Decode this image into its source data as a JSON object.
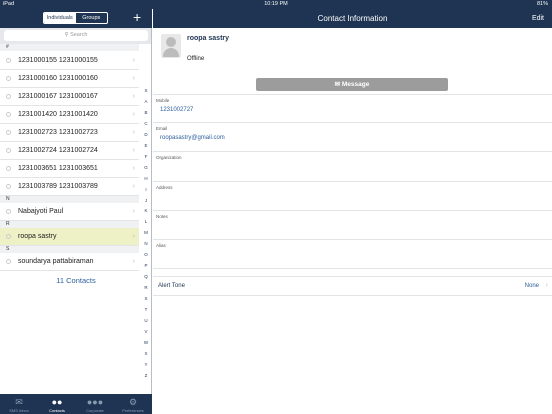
{
  "status": {
    "carrier": "iPad",
    "time": "10:19 PM",
    "battery": "81%"
  },
  "left_header": {
    "seg_individuals": "Individuals",
    "seg_groups": "Groups",
    "add": "+"
  },
  "search": {
    "placeholder": "Search"
  },
  "sections": {
    "hash": "#",
    "n": "N",
    "r": "R",
    "s": "S"
  },
  "contacts": [
    "1231000155 1231000155",
    "1231000160 1231000160",
    "1231000167 1231000167",
    "1231001420 1231001420",
    "1231002723 1231002723",
    "1231002724 1231002724",
    "1231003651 1231003651",
    "1231003789 1231003789",
    "Nabajyoti Paul",
    "roopa sastry",
    "soundarya pattabiraman"
  ],
  "contact_count": "11 Contacts",
  "index": [
    "S",
    "A",
    "B",
    "C",
    "D",
    "E",
    "F",
    "G",
    "H",
    "I",
    "J",
    "K",
    "L",
    "M",
    "N",
    "O",
    "P",
    "Q",
    "R",
    "S",
    "T",
    "U",
    "V",
    "W",
    "X",
    "Y",
    "Z"
  ],
  "tabbar": [
    {
      "label": "SMS Inbox",
      "icon": "envelope-icon"
    },
    {
      "label": "Contacts",
      "icon": "people-icon"
    },
    {
      "label": "Corporate",
      "icon": "group-icon"
    },
    {
      "label": "Preferences",
      "icon": "gear-icon"
    }
  ],
  "right_header": {
    "title": "Contact Information",
    "edit": "Edit"
  },
  "contact": {
    "name": "roopa sastry",
    "status": "Offline",
    "message_button": "Message",
    "fields": [
      {
        "label": "Mobile",
        "value": "1231002727"
      },
      {
        "label": "Email",
        "value": "roopasastry@gmail.com"
      },
      {
        "label": "Organization",
        "value": ""
      },
      {
        "label": "Address",
        "value": ""
      },
      {
        "label": "Notes",
        "value": ""
      },
      {
        "label": "Alias",
        "value": ""
      }
    ],
    "alert_tone_label": "Alert Tone",
    "alert_tone_value": "None"
  },
  "colors": {
    "nav": "#1e3452",
    "link": "#2c5f9e",
    "selected_row": "#eef0c5"
  }
}
